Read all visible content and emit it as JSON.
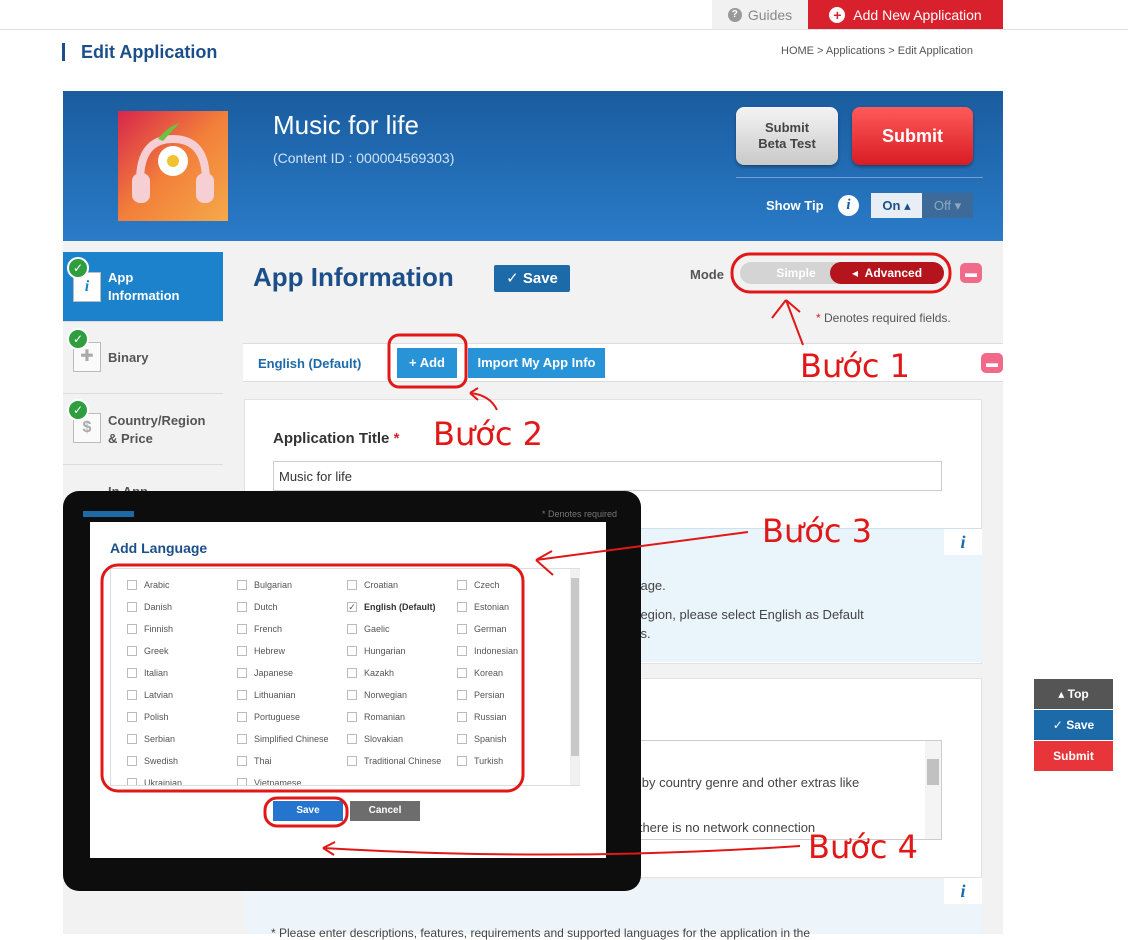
{
  "topbar": {
    "guides": "Guides",
    "add_new": "Add New Application"
  },
  "page": {
    "title": "Edit Application",
    "breadcrumb": "HOME  >  Applications  >  Edit Application"
  },
  "banner": {
    "app_name": "Music for life",
    "content_id": "(Content ID : 000004569303)",
    "beta_line1": "Submit",
    "beta_line2": "Beta Test",
    "submit": "Submit",
    "show_tip": "Show Tip",
    "tip_on": "On",
    "tip_off": "Off"
  },
  "sidebar": {
    "items": [
      {
        "label1": "App",
        "label2": "Information"
      },
      {
        "label1": "Binary",
        "label2": ""
      },
      {
        "label1": "Country/Region",
        "label2": "& Price"
      },
      {
        "label1": "In App",
        "label2": ""
      }
    ]
  },
  "main": {
    "section_title": "App Information",
    "save": "Save",
    "mode_label": "Mode",
    "mode_simple": "Simple",
    "mode_advanced": "Advanced",
    "required_note": "Denotes required fields.",
    "tab_english": "English (Default)",
    "tab_add": "Add",
    "tab_import": "Import My App Info",
    "app_title_label": "Application Title",
    "app_title_value": "Music for life",
    "info_line1": "guage.",
    "info_line2": "y/region, please select English as Default",
    "info_line3": "ries.",
    "desc_line1": "ld by country genre and other extras like",
    "desc_line2": "n there is no network connection",
    "bottom_line": "* Please enter descriptions, features, requirements and supported languages for the application in the"
  },
  "float": {
    "top": "Top",
    "save": "Save",
    "submit": "Submit"
  },
  "dialog": {
    "required": "* Denotes required",
    "title": "Add Language",
    "save": "Save",
    "cancel": "Cancel",
    "languages": [
      "Arabic",
      "Bulgarian",
      "Croatian",
      "Czech",
      "Danish",
      "Dutch",
      "English (Default)",
      "Estonian",
      "Finnish",
      "French",
      "Gaelic",
      "German",
      "Greek",
      "Hebrew",
      "Hungarian",
      "Indonesian",
      "Italian",
      "Japanese",
      "Kazakh",
      "Korean",
      "Latvian",
      "Lithuanian",
      "Norwegian",
      "Persian",
      "Polish",
      "Portuguese",
      "Romanian",
      "Russian",
      "Serbian",
      "Simplified Chinese",
      "Slovakian",
      "Spanish",
      "Swedish",
      "Thai",
      "Traditional Chinese",
      "Turkish",
      "Ukrainian",
      "Vietnamese"
    ],
    "checked": "English (Default)"
  },
  "annotations": {
    "step1": "Bước 1",
    "step2": "Bước 2",
    "step3": "Bước 3",
    "step4": "Bước 4"
  },
  "colors": {
    "brand_blue": "#1c4f8a",
    "accent_red": "#d9202d",
    "annotation_red": "#e01818"
  }
}
